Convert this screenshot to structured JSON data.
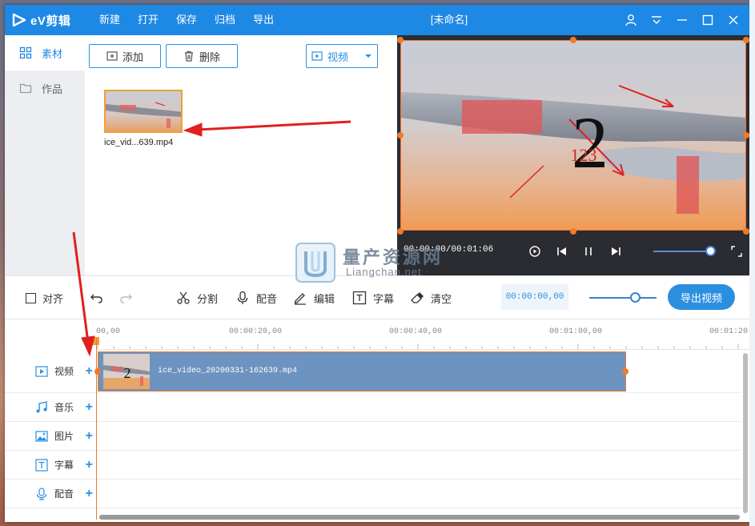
{
  "app": {
    "logo_text": "eV剪辑",
    "window_title": "[未命名]",
    "menu": [
      "新建",
      "打开",
      "保存",
      "归档",
      "导出"
    ]
  },
  "sidebar": {
    "items": [
      {
        "label": "素材",
        "icon": "grid-icon"
      },
      {
        "label": "作品",
        "icon": "folder-icon"
      }
    ]
  },
  "media": {
    "add_label": "添加",
    "delete_label": "删除",
    "filter_label": "视频",
    "file_name": "ice_vid...639.mp4"
  },
  "preview": {
    "timecode": "00:00:00/00:01:06",
    "overlay_number": "2",
    "overlay_small": "123"
  },
  "toolbar": {
    "align_label": "对齐",
    "split_label": "分割",
    "dub_label": "配音",
    "edit_label": "编辑",
    "subtitle_label": "字幕",
    "clear_label": "清空",
    "current_time": "00:00:00,00",
    "export_label": "导出视频"
  },
  "timeline": {
    "ruler": [
      "00,00",
      "00:00:20,00",
      "00:00:40,00",
      "00:01:00,00",
      "00:01:20"
    ],
    "tracks": [
      {
        "label": "视频",
        "icon": "video-icon"
      },
      {
        "label": "音乐",
        "icon": "music-icon"
      },
      {
        "label": "图片",
        "icon": "image-icon"
      },
      {
        "label": "字幕",
        "icon": "text-icon"
      },
      {
        "label": "配音",
        "icon": "mic-icon"
      }
    ],
    "clip_name": "ice_video_20200331-162639.mp4"
  },
  "watermark": {
    "line1": "量产资源网",
    "line2": "Liangchan.net"
  },
  "colors": {
    "accent": "#1e88e5",
    "annotation": "#e02020",
    "selection": "#f07a2a"
  }
}
